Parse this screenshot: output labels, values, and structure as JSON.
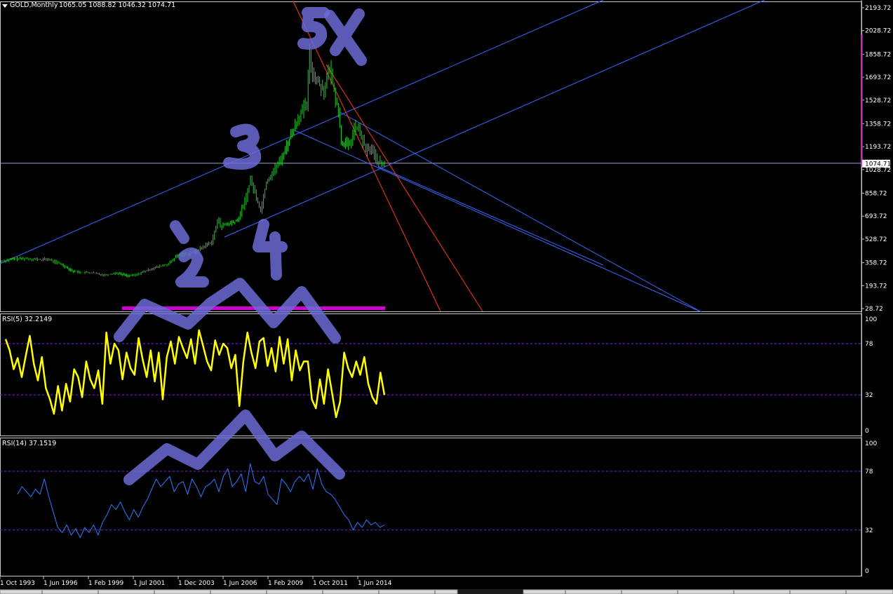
{
  "header": {
    "symbol": "GOLD,Monthly",
    "ohlc": "1065.05 1088.82 1046.32 1074.71"
  },
  "colors": {
    "background": "#000000",
    "candle": "#1fd32a",
    "price_line": "#9aa0c8",
    "trend_line": "#3a66ff",
    "red_line": "#ff3a1a",
    "magenta": "#d000d0",
    "rsi5": "#ffff00",
    "rsi14": "#2f7bff",
    "level_line": "#7a2bd6",
    "annotation": "#6b6bd6"
  },
  "annotations": [
    "5X",
    "3",
    "`",
    "2",
    "4"
  ],
  "chart_data": [
    {
      "type": "candlestick",
      "title": "GOLD,Monthly",
      "last_price": "1074.71",
      "y_ticks": [
        "2193.72",
        "2028.72",
        "1858.72",
        "1693.72",
        "1528.72",
        "1358.72",
        "1193.72",
        "1028.72",
        "858.72",
        "693.72",
        "528.72",
        "358.72",
        "193.72",
        "28.72"
      ],
      "ylim": [
        28.72,
        2193.72
      ],
      "x_tick_labels": [
        "1 Oct 1993",
        "1 Jun 1996",
        "1 Feb 1999",
        "1 Jul 2001",
        "1 Dec 2003",
        "1 Jun 2006",
        "1 Feb 2009",
        "1 Oct 2011",
        "1 Jun 2014"
      ],
      "price_path": [
        [
          "1993-10",
          370
        ],
        [
          "1994-06",
          385
        ],
        [
          "1995-03",
          390
        ],
        [
          "1996-01",
          380
        ],
        [
          "1996-06",
          385
        ],
        [
          "1997-03",
          350
        ],
        [
          "1997-12",
          295
        ],
        [
          "1998-06",
          290
        ],
        [
          "1999-02",
          285
        ],
        [
          "1999-09",
          270
        ],
        [
          "2000-06",
          285
        ],
        [
          "2001-02",
          265
        ],
        [
          "2001-07",
          270
        ],
        [
          "2002-06",
          315
        ],
        [
          "2003-06",
          350
        ],
        [
          "2003-12",
          410
        ],
        [
          "2004-12",
          435
        ],
        [
          "2005-12",
          510
        ],
        [
          "2006-05",
          680
        ],
        [
          "2006-06",
          620
        ],
        [
          "2007-06",
          660
        ],
        [
          "2007-12",
          830
        ],
        [
          "2008-03",
          960
        ],
        [
          "2008-10",
          730
        ],
        [
          "2009-02",
          940
        ],
        [
          "2009-12",
          1100
        ],
        [
          "2010-12",
          1400
        ],
        [
          "2011-06",
          1500
        ],
        [
          "2011-08",
          1860
        ],
        [
          "2011-10",
          1720
        ],
        [
          "2012-06",
          1600
        ],
        [
          "2012-10",
          1760
        ],
        [
          "2013-04",
          1440
        ],
        [
          "2013-06",
          1230
        ],
        [
          "2013-12",
          1200
        ],
        [
          "2014-03",
          1330
        ],
        [
          "2014-06",
          1320
        ],
        [
          "2014-11",
          1170
        ],
        [
          "2015-03",
          1180
        ],
        [
          "2015-07",
          1090
        ],
        [
          "2015-11",
          1060
        ],
        [
          "2015-12",
          1074.71
        ]
      ]
    },
    {
      "type": "line",
      "title": "RSI(5) 32.2149",
      "ylim": [
        0,
        100
      ],
      "y_ticks": [
        100,
        78,
        32,
        0
      ],
      "levels": [
        78,
        32
      ],
      "series": [
        {
          "name": "RSI(5)",
          "values": [
            82,
            72,
            55,
            65,
            48,
            67,
            85,
            60,
            45,
            66,
            38,
            28,
            15,
            40,
            18,
            42,
            26,
            55,
            48,
            30,
            62,
            46,
            38,
            54,
            24,
            88,
            60,
            78,
            72,
            46,
            70,
            56,
            50,
            83,
            64,
            48,
            72,
            44,
            70,
            28,
            66,
            80,
            60,
            84,
            74,
            65,
            82,
            60,
            90,
            76,
            62,
            54,
            81,
            68,
            78,
            74,
            56,
            68,
            22,
            62,
            88,
            70,
            56,
            80,
            83,
            58,
            74,
            53,
            84,
            60,
            82,
            45,
            72,
            54,
            62,
            62,
            28,
            20,
            46,
            24,
            55,
            34,
            12,
            26,
            70,
            56,
            48,
            62,
            50,
            66,
            42,
            30,
            24,
            52,
            32
          ]
        }
      ]
    },
    {
      "type": "line",
      "title": "RSI(14) 37.1519",
      "ylim": [
        0,
        100
      ],
      "y_ticks": [
        100,
        78,
        32,
        0
      ],
      "levels": [
        78,
        32
      ],
      "series": [
        {
          "name": "RSI(14)",
          "values": [
            60,
            66,
            62,
            58,
            64,
            60,
            72,
            58,
            46,
            34,
            30,
            36,
            28,
            33,
            26,
            34,
            30,
            36,
            28,
            38,
            44,
            52,
            48,
            54,
            46,
            40,
            48,
            42,
            50,
            56,
            64,
            72,
            66,
            70,
            74,
            62,
            68,
            70,
            60,
            72,
            66,
            58,
            66,
            68,
            72,
            62,
            74,
            80,
            66,
            70,
            76,
            62,
            84,
            70,
            68,
            74,
            60,
            56,
            52,
            72,
            68,
            62,
            70,
            74,
            70,
            76,
            64,
            80,
            68,
            62,
            60,
            56,
            50,
            44,
            40,
            32,
            38,
            34,
            40,
            36,
            38,
            34,
            36
          ]
        }
      ]
    }
  ]
}
